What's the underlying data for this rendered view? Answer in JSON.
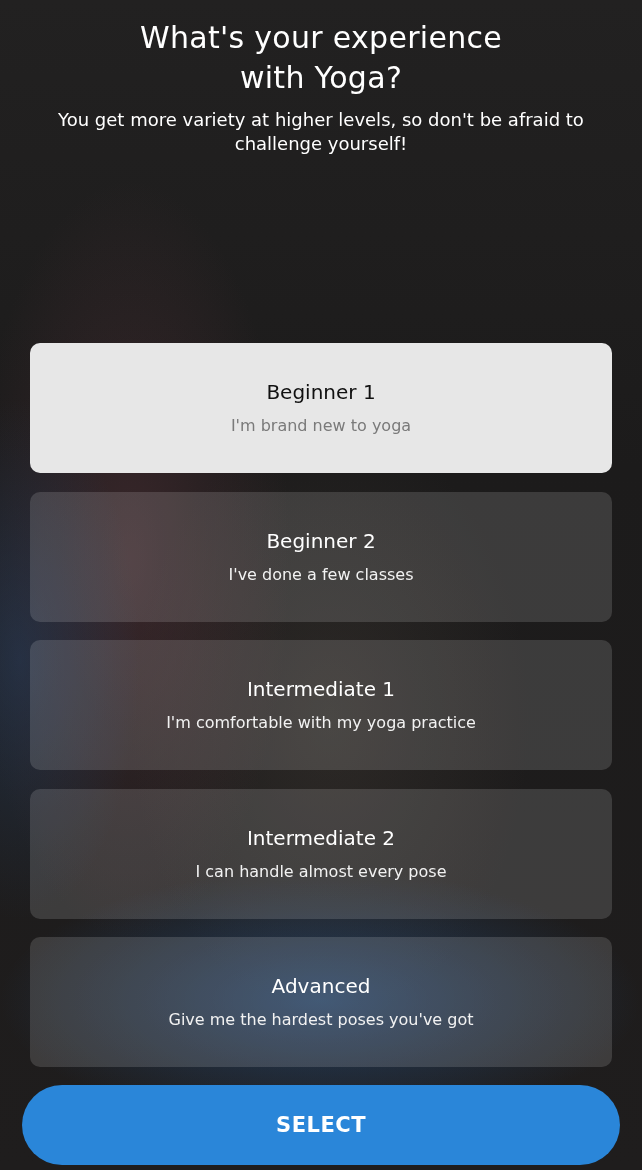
{
  "header": {
    "title": "What's your experience with Yoga?",
    "subtitle": "You get more variety at higher levels, so don't be afraid to challenge yourself!"
  },
  "levels": [
    {
      "title": "Beginner 1",
      "description": "I'm brand new to yoga",
      "selected": true
    },
    {
      "title": "Beginner 2",
      "description": "I've done a few classes",
      "selected": false
    },
    {
      "title": "Intermediate 1",
      "description": "I'm comfortable with my yoga practice",
      "selected": false
    },
    {
      "title": "Intermediate 2",
      "description": "I can handle almost every pose",
      "selected": false
    },
    {
      "title": "Advanced",
      "description": "Give me the hardest poses you've got",
      "selected": false
    }
  ],
  "select_button": {
    "label": "SELECT"
  }
}
